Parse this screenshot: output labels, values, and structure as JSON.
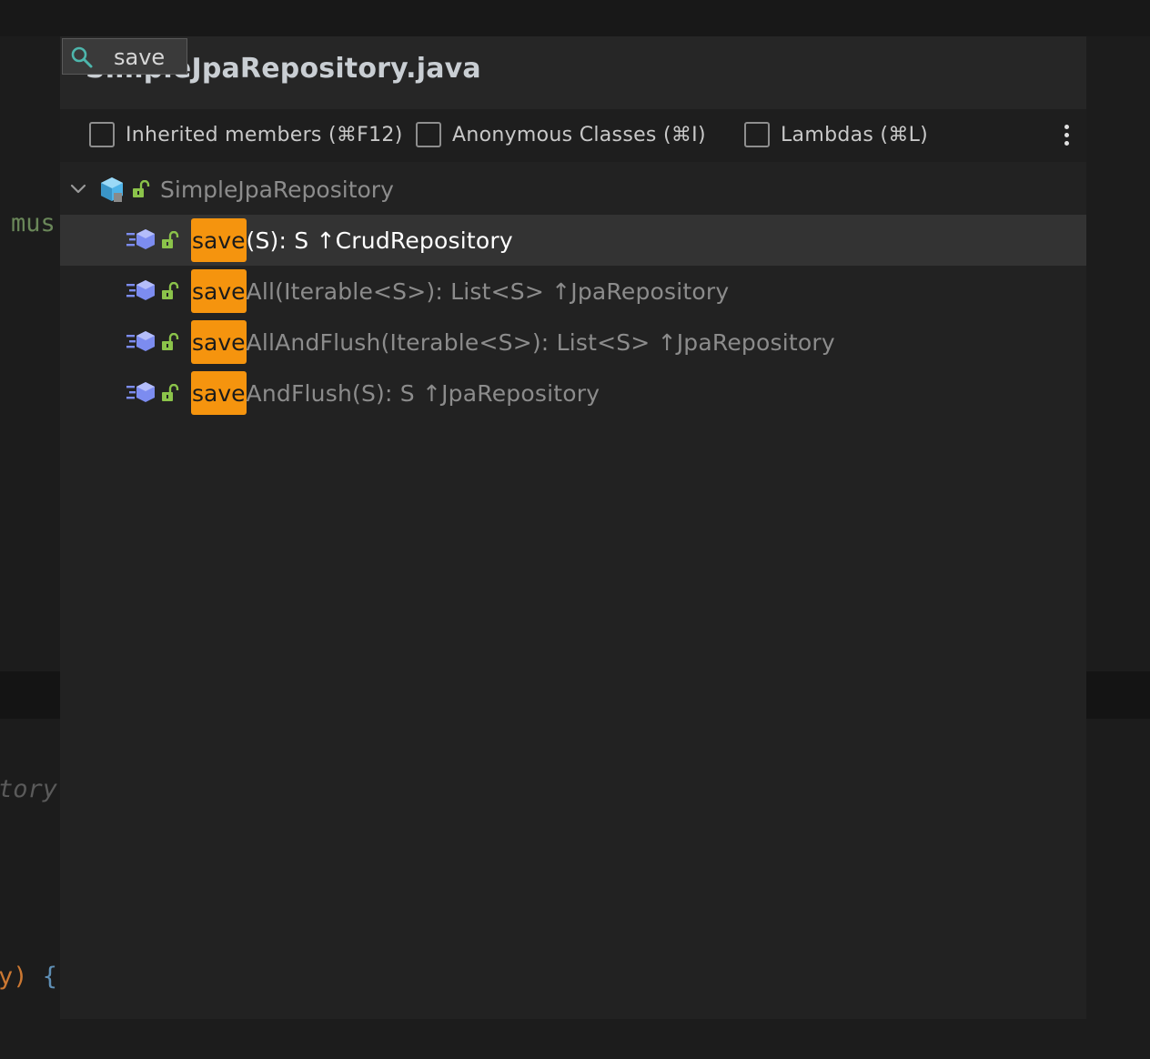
{
  "background_editor": {
    "code_fragment_1": "mus",
    "code_fragment_2": "tory",
    "code_fragment_3a": "y)",
    "code_fragment_3b": " {"
  },
  "popup": {
    "title": "SimpleJpaRepository.java",
    "speed_search": {
      "query": "save",
      "icon": "search-icon"
    },
    "filters": [
      {
        "label": "Inherited members (⌘F12)",
        "checked": false
      },
      {
        "label": "Anonymous Classes (⌘I)",
        "checked": false
      },
      {
        "label": "Lambdas (⌘L)",
        "checked": false
      }
    ],
    "more_icon": "more-vertical-icon"
  },
  "tree": {
    "root": {
      "label": "SimpleJpaRepository",
      "expanded": true,
      "icons": [
        "chevron-down-icon",
        "class-icon",
        "public-lock-icon"
      ]
    },
    "items": [
      {
        "match": "save",
        "rest": "(S): S ↑CrudRepository",
        "selected": true
      },
      {
        "match": "save",
        "rest": "All(Iterable<S>): List<S> ↑JpaRepository",
        "selected": false
      },
      {
        "match": "save",
        "rest": "AllAndFlush(Iterable<S>): List<S> ↑JpaRepository",
        "selected": false
      },
      {
        "match": "save",
        "rest": "AndFlush(S): S ↑JpaRepository",
        "selected": false
      }
    ]
  },
  "colors": {
    "match_highlight": "#f5940e",
    "selected_row": "#333333",
    "class_icon": "#4fb3e8",
    "method_icon": "#7c8cf0",
    "lock_icon": "#8bc34a"
  }
}
